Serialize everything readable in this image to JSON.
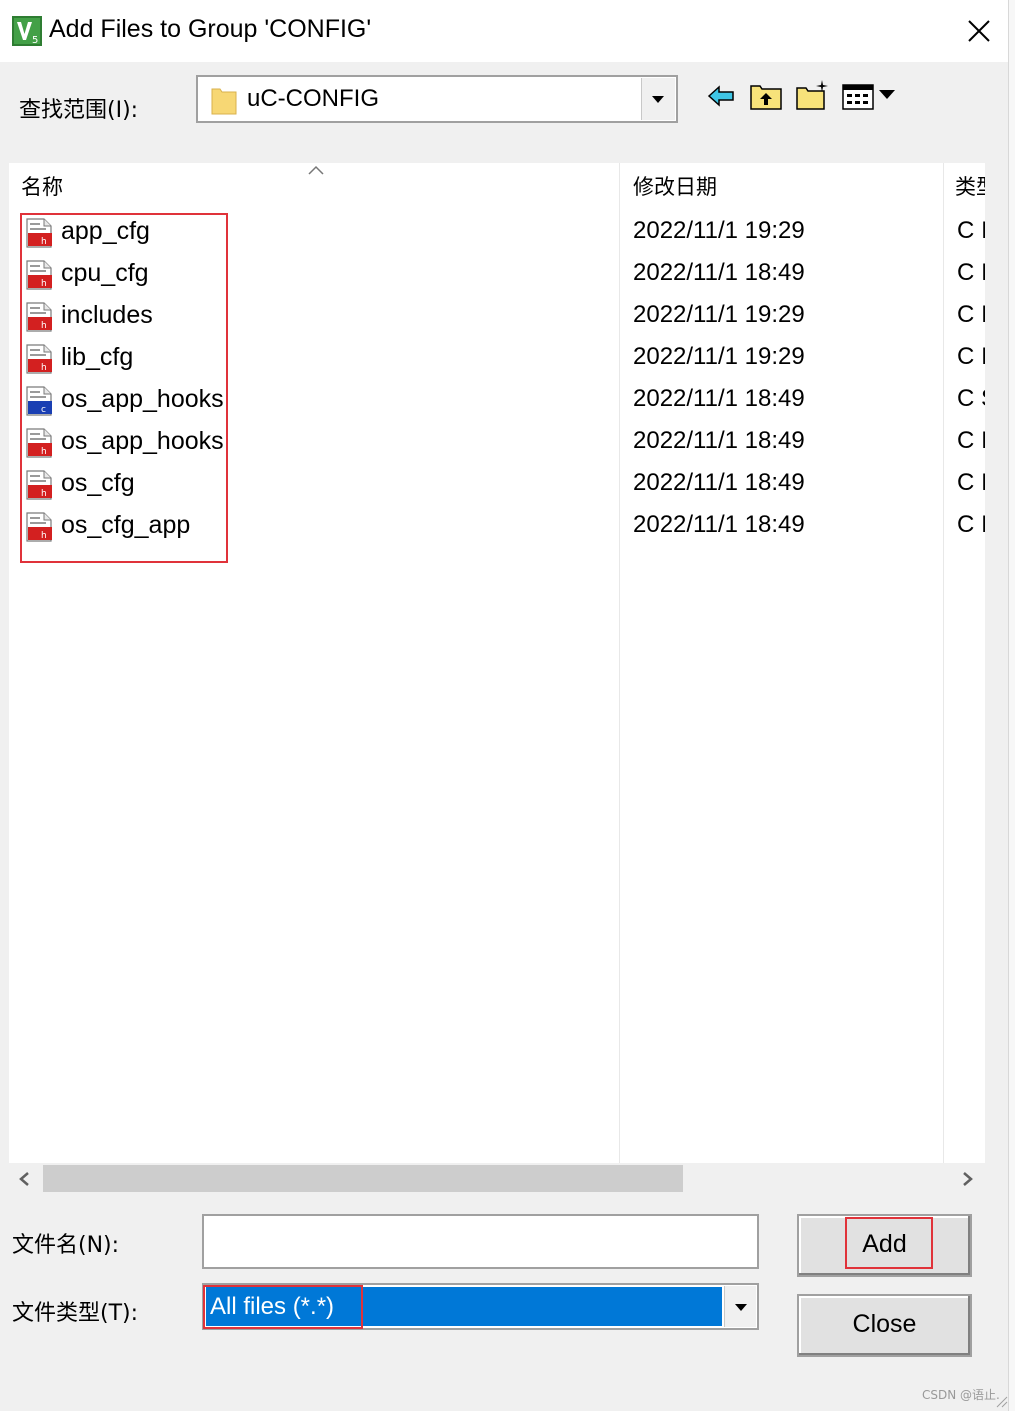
{
  "window": {
    "title": "Add Files to Group 'CONFIG'"
  },
  "look_in": {
    "label": "查找范围(I):",
    "value": "uC-CONFIG"
  },
  "toolbar": {
    "icons": [
      "back-arrow-icon",
      "up-folder-icon",
      "new-folder-icon",
      "view-menu-icon"
    ]
  },
  "file_list": {
    "headers": {
      "name": "名称",
      "modified": "修改日期",
      "type": "类型"
    },
    "rows": [
      {
        "name": "app_cfg",
        "modified": "2022/11/1 19:29",
        "type": "C I",
        "icon": "h-file-icon"
      },
      {
        "name": "cpu_cfg",
        "modified": "2022/11/1 18:49",
        "type": "C I",
        "icon": "h-file-icon"
      },
      {
        "name": "includes",
        "modified": "2022/11/1 19:29",
        "type": "C I",
        "icon": "h-file-icon"
      },
      {
        "name": "lib_cfg",
        "modified": "2022/11/1 19:29",
        "type": "C I",
        "icon": "h-file-icon"
      },
      {
        "name": "os_app_hooks",
        "modified": "2022/11/1 18:49",
        "type": "C S",
        "icon": "c-file-icon"
      },
      {
        "name": "os_app_hooks",
        "modified": "2022/11/1 18:49",
        "type": "C I",
        "icon": "h-file-icon"
      },
      {
        "name": "os_cfg",
        "modified": "2022/11/1 18:49",
        "type": "C I",
        "icon": "h-file-icon"
      },
      {
        "name": "os_cfg_app",
        "modified": "2022/11/1 18:49",
        "type": "C I",
        "icon": "h-file-icon"
      }
    ]
  },
  "file_name": {
    "label": "文件名(N):",
    "value": ""
  },
  "file_type": {
    "label": "文件类型(T):",
    "value": "All files (*.*)"
  },
  "buttons": {
    "add": "Add",
    "close": "Close"
  },
  "watermark": "CSDN @语止.",
  "colors": {
    "highlight": "#e0323a",
    "selection": "#0078d7",
    "folder": "#f7d774"
  }
}
